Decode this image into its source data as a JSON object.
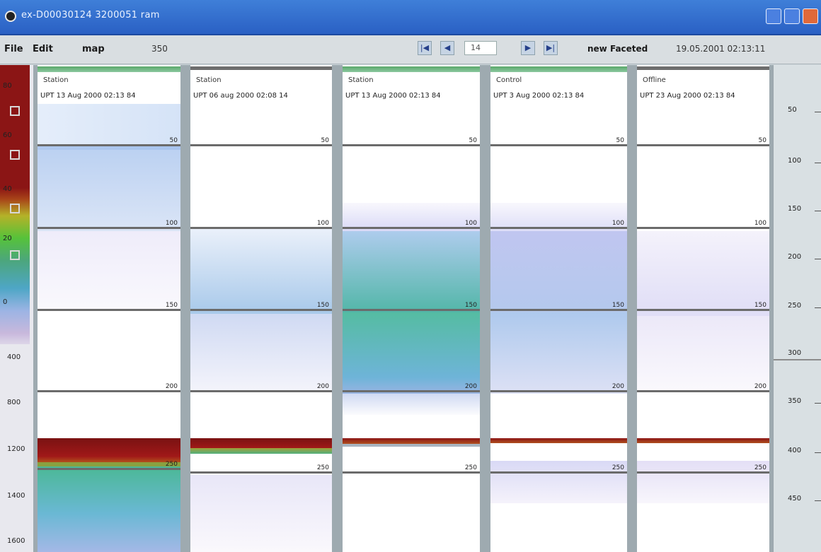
{
  "window": {
    "title": "ex-D00030124 3200051 ram"
  },
  "menubar": {
    "file": "File",
    "edit": "Edit",
    "map": "map",
    "field": "350"
  },
  "nav": {
    "first": "|◀",
    "prev": "◀",
    "page": "14",
    "next": "▶",
    "last": "▶|",
    "status_left": "new Faceted",
    "status_right": "19.05.2001 02:13:11"
  },
  "scale": {
    "labels": [
      "80",
      "60",
      "40",
      "20",
      "0"
    ],
    "depths": [
      "400",
      "800",
      "1200",
      "1400",
      "1600"
    ]
  },
  "panels": [
    {
      "name": "Station",
      "time": "UPT 13 Aug 2000 02:13 84"
    },
    {
      "name": "Station",
      "time": "UPT 06 aug 2000 02:08 14"
    },
    {
      "name": "Station",
      "time": "UPT 13 Aug 2000 02:13 84"
    },
    {
      "name": "Control",
      "time": "UPT 3 Aug 2000 02:13 84"
    },
    {
      "name": "Offline",
      "time": "UPT 23 Aug 2000 02:13 84"
    }
  ],
  "depth_marks": [
    "50",
    "100",
    "150",
    "200",
    "250"
  ],
  "right_axis": {
    "labels": [
      "50",
      "100",
      "150",
      "200",
      "250",
      "300",
      "350",
      "400",
      "450"
    ]
  },
  "colors": {
    "accent": "#2a60c4",
    "seabed": "#8b1515"
  }
}
